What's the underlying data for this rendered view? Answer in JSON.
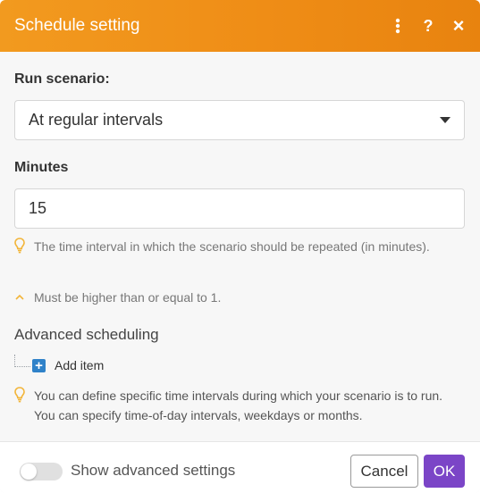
{
  "header": {
    "title": "Schedule setting",
    "icons": [
      "more-vertical-icon",
      "help-icon",
      "close-icon"
    ],
    "help_glyph": "?",
    "close_glyph": "×",
    "more_glyph": "⋮"
  },
  "run_scenario": {
    "label": "Run scenario:",
    "selected": "At regular intervals"
  },
  "minutes": {
    "label": "Minutes",
    "value": "15",
    "hint": "The time interval in which the scenario should be repeated (in minutes).",
    "validation": "Must be higher than or equal to 1."
  },
  "advanced_scheduling": {
    "label": "Advanced scheduling",
    "add_item_label": "Add item",
    "hint": "You can define specific time intervals during which your scenario is to run. You can specify time-of-day intervals, weekdays or months."
  },
  "footer": {
    "toggle_label": "Show advanced settings",
    "toggle_on": false,
    "cancel_label": "Cancel",
    "ok_label": "OK"
  },
  "colors": {
    "header": "#ef8d16",
    "primary_button": "#7b45c7",
    "add_icon": "#2f82c9",
    "hint_icon": "#f2b53a"
  }
}
